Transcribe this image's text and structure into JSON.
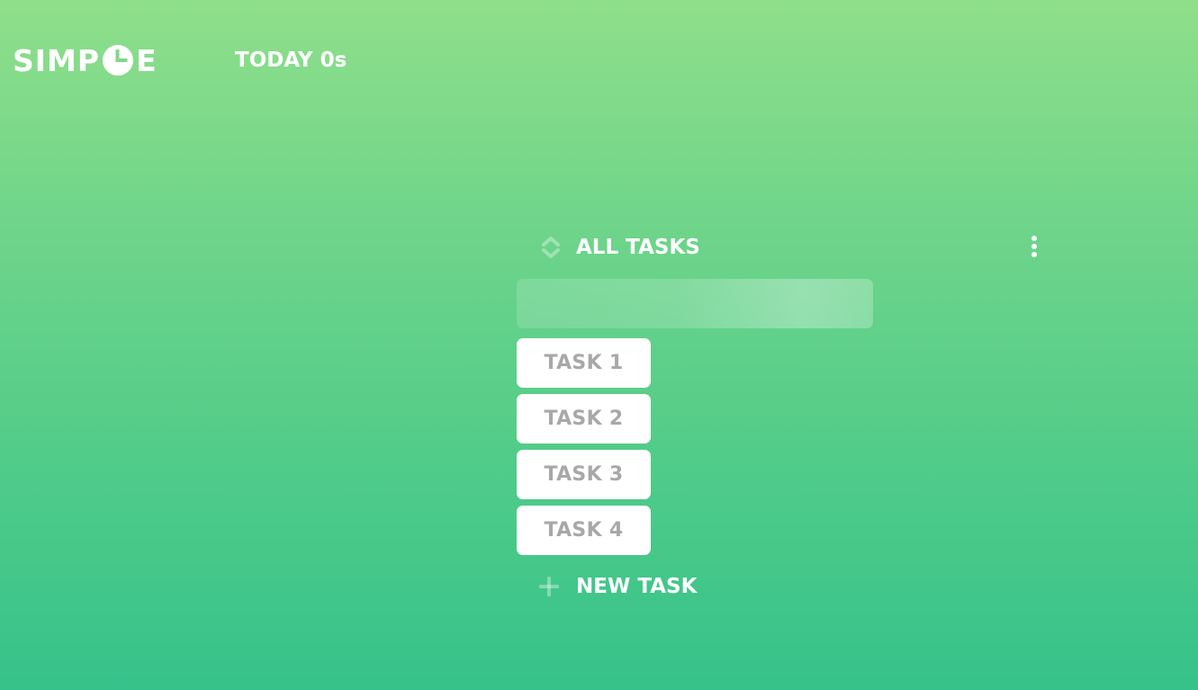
{
  "app": {
    "logo_left": "SIMP",
    "logo_right": "E",
    "today_label": "TODAY 0s"
  },
  "list": {
    "title": "ALL TASKS",
    "search": {
      "value": "",
      "placeholder": ""
    },
    "tasks": [
      {
        "label": "TASK 1"
      },
      {
        "label": "TASK 2"
      },
      {
        "label": "TASK 3"
      },
      {
        "label": "TASK 4"
      }
    ],
    "new_task_label": "NEW TASK"
  },
  "icons": {
    "logo": "clock-icon",
    "sort": "sort-arrows-icon",
    "menu": "kebab-menu-icon",
    "add": "plus-icon"
  },
  "colors": {
    "background_top": "#8fdf8a",
    "background_bottom": "#36c28a",
    "text": "#ffffff",
    "task_text": "#a8a8a8",
    "task_bg": "#ffffff"
  }
}
